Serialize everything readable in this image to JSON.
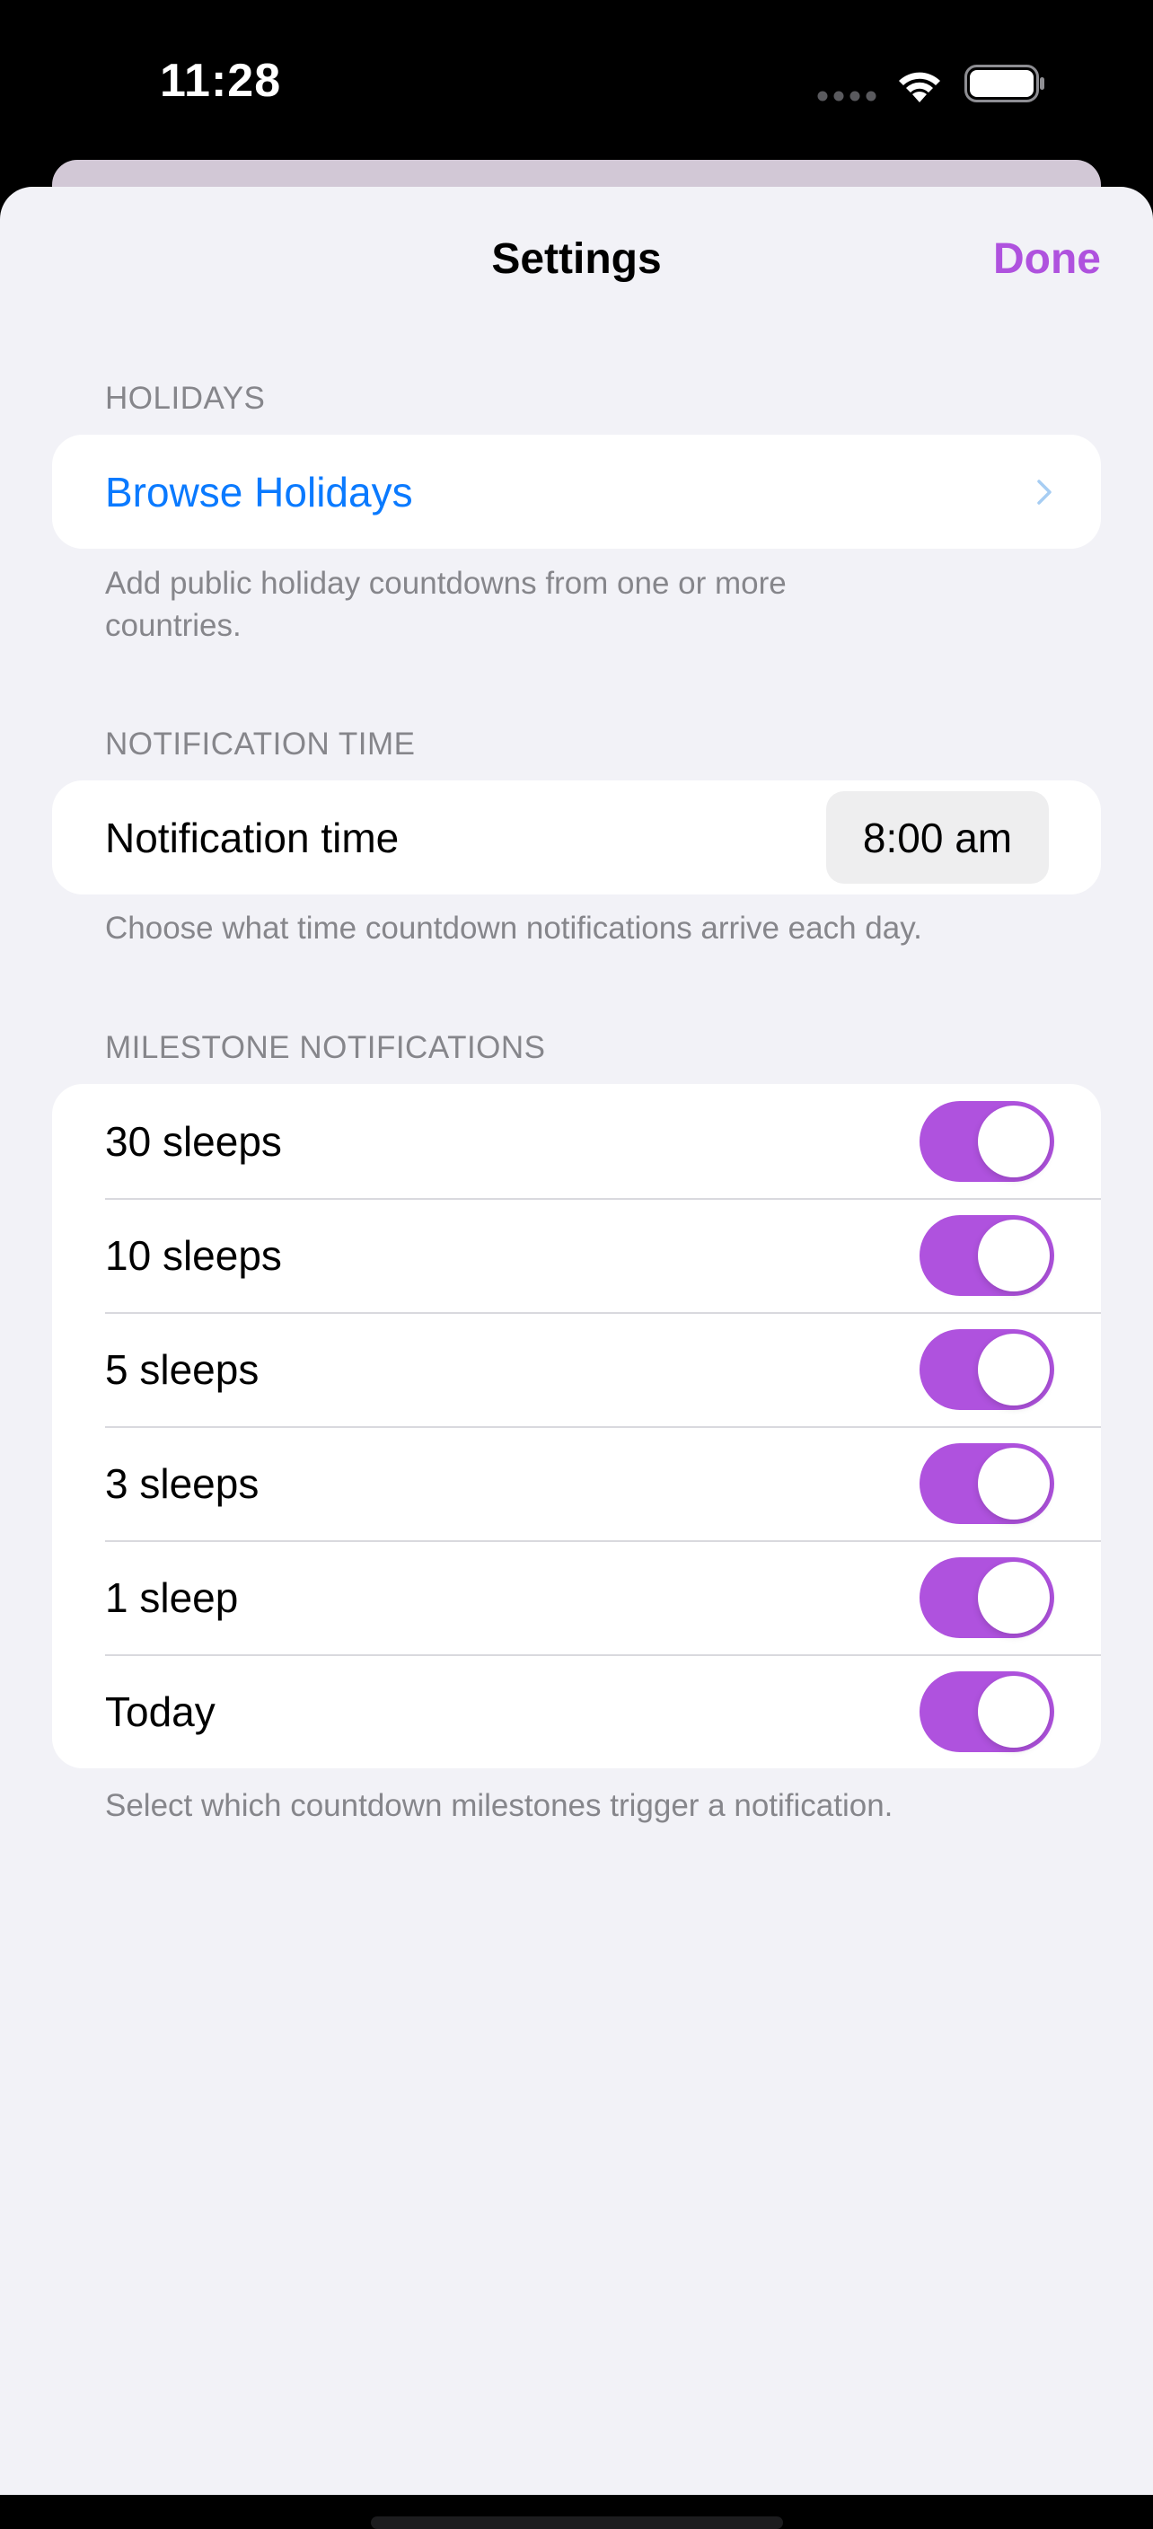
{
  "status_bar": {
    "time": "11:28",
    "icons": [
      "signal-dots-icon",
      "wifi-icon",
      "battery-icon"
    ]
  },
  "nav": {
    "title": "Settings",
    "done_label": "Done"
  },
  "colors": {
    "accent": "#af52de",
    "link": "#0a7aff",
    "background": "#f2f2f7",
    "secondary_text": "#86868b"
  },
  "holidays": {
    "header": "HOLIDAYS",
    "browse_label": "Browse Holidays",
    "footer": "Add public holiday countdowns from one or more countries."
  },
  "notification_time": {
    "header": "NOTIFICATION TIME",
    "label": "Notification time",
    "value": "8:00 am",
    "footer": "Choose what time countdown notifications arrive each day."
  },
  "milestones": {
    "header": "MILESTONE NOTIFICATIONS",
    "items": [
      {
        "label": "30 sleeps",
        "enabled": true
      },
      {
        "label": "10 sleeps",
        "enabled": true
      },
      {
        "label": "5 sleeps",
        "enabled": true
      },
      {
        "label": "3 sleeps",
        "enabled": true
      },
      {
        "label": "1 sleep",
        "enabled": true
      },
      {
        "label": "Today",
        "enabled": true
      }
    ],
    "footer": "Select which countdown milestones trigger a notification."
  }
}
